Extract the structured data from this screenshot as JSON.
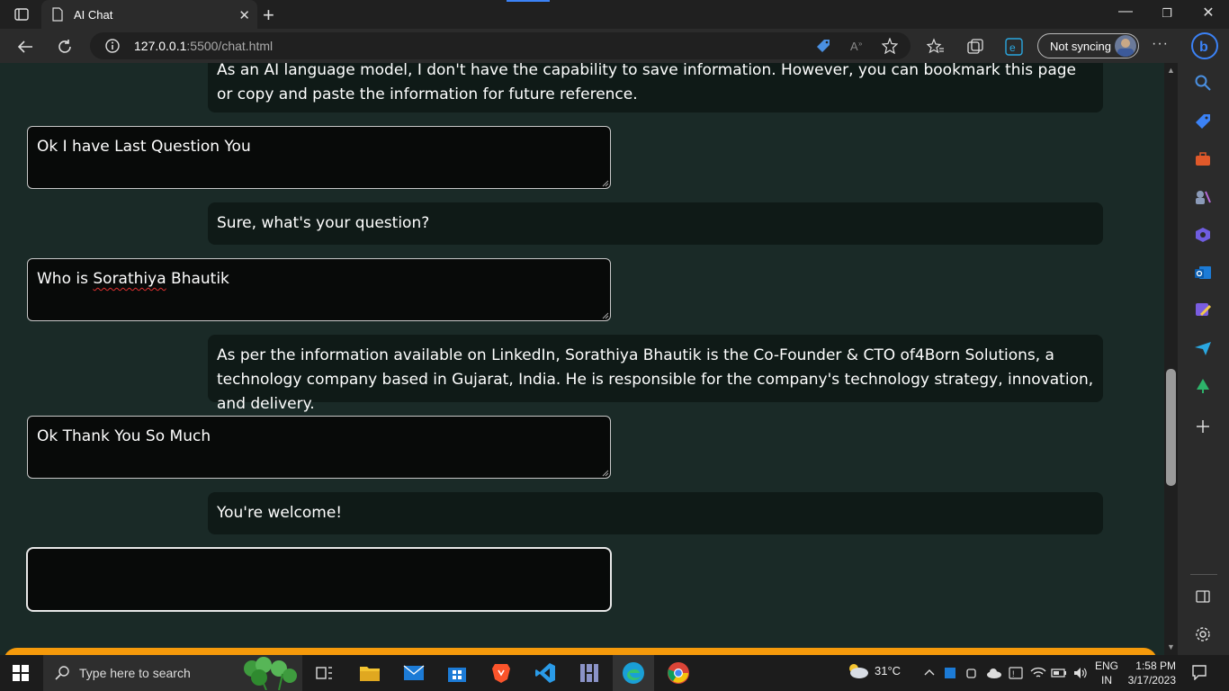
{
  "browser": {
    "tab_title": "AI Chat",
    "url_host": "127.0.0.1",
    "url_rest": ":5500/chat.html",
    "profile_label": "Not syncing"
  },
  "chat": {
    "messages": [
      {
        "role": "ai",
        "text": "As an AI language model, I don't have the capability to save information. However, you can bookmark this page or copy and paste the information for future reference."
      },
      {
        "role": "user",
        "text": "Ok I have Last Question You"
      },
      {
        "role": "ai",
        "text": "Sure, what's your question?"
      },
      {
        "role": "user",
        "text_prefix": "Who is ",
        "text_spell": "Sorathiya",
        "text_suffix": " Bhautik"
      },
      {
        "role": "ai",
        "text": "As per the information available on LinkedIn, Sorathiya Bhautik is the Co-Founder & CTO of4Born Solutions, a technology company based in Gujarat, India. He is responsible for the company's technology strategy, innovation, and delivery."
      },
      {
        "role": "user",
        "text": "Ok Thank You So Much"
      },
      {
        "role": "ai",
        "text": "You're welcome!"
      }
    ],
    "input_value": ""
  },
  "taskbar": {
    "search_placeholder": "Type here to search",
    "temperature": "31°C",
    "lang_top": "ENG",
    "lang_bottom": "IN",
    "time": "1:58 PM",
    "date": "3/17/2023"
  },
  "colors": {
    "page_bg": "#1a2a27",
    "ai_bubble": "#0f1a17",
    "user_bubble": "#080a09",
    "footer_bar": "#f59a0b"
  }
}
